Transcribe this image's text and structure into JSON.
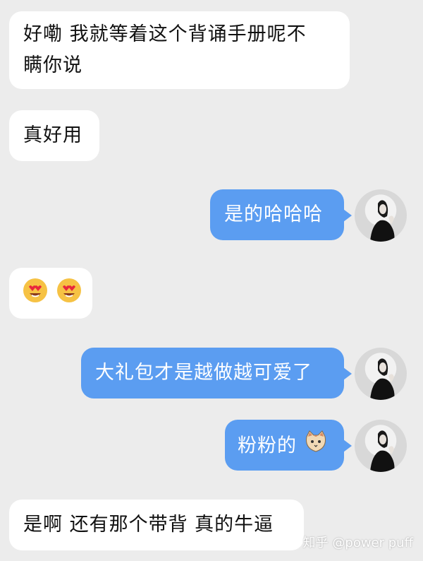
{
  "messages": [
    {
      "side": "left",
      "line1": "好嘞 我就等着这个背诵手册呢不",
      "line2": "瞒你说"
    },
    {
      "side": "left",
      "text": "真好用"
    },
    {
      "side": "right",
      "text": "是的哈哈哈"
    },
    {
      "side": "left",
      "emoji": [
        "heart-eyes-emoji",
        "heart-eyes-emoji"
      ]
    },
    {
      "side": "right",
      "text": "大礼包才是越做越可爱了"
    },
    {
      "side": "right",
      "text": "粉粉的",
      "emoji": "cat-face-emoji"
    },
    {
      "side": "left",
      "text": "是啊 还有那个带背 真的牛逼"
    }
  ],
  "watermark": "知乎 @power puff",
  "colors": {
    "background": "#ececec",
    "incoming": "#ffffff",
    "outgoing": "#5b9df1"
  }
}
